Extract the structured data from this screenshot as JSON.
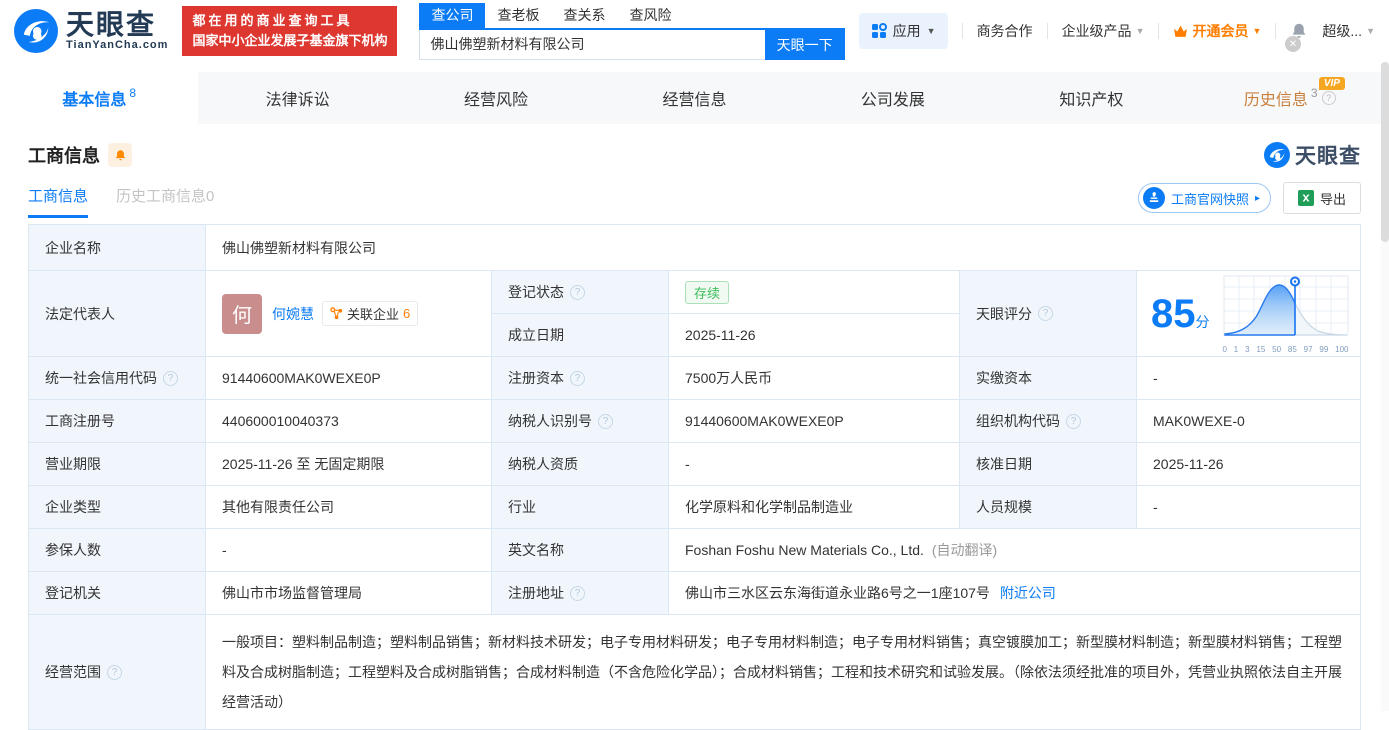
{
  "header": {
    "logo_title": "天眼查",
    "logo_domain": "TianYanCha.com",
    "slogan_line1": "都在用的商业查询工具",
    "slogan_line2": "国家中小企业发展子基金旗下机构",
    "search_tabs": [
      {
        "label": "查公司"
      },
      {
        "label": "查老板"
      },
      {
        "label": "查关系"
      },
      {
        "label": "查风险"
      }
    ],
    "search_value": "佛山佛塑新材料有限公司",
    "search_button": "天眼一下",
    "nav_apps": "应用",
    "nav_cooperation": "商务合作",
    "nav_enterprise": "企业级产品",
    "nav_vip": "开通会员",
    "nav_more": "超级..."
  },
  "tabs": [
    {
      "label": "基本信息",
      "count": "8"
    },
    {
      "label": "法律诉讼"
    },
    {
      "label": "经营风险"
    },
    {
      "label": "经营信息"
    },
    {
      "label": "公司发展"
    },
    {
      "label": "知识产权"
    },
    {
      "label": "历史信息",
      "count": "3",
      "badge": "VIP"
    }
  ],
  "section": {
    "title": "工商信息",
    "watermark": "天眼查",
    "subtab_active": "工商信息",
    "subtab_history": "历史工商信息0",
    "btn_snapshot": "工商官网快照",
    "btn_export": "导出"
  },
  "fields": {
    "company_name": {
      "label": "企业名称",
      "value": "佛山佛塑新材料有限公司"
    },
    "legal_rep": {
      "label": "法定代表人",
      "avatar": "何",
      "name": "何婉慧",
      "related_label": "关联企业",
      "related_count": "6"
    },
    "reg_status": {
      "label": "登记状态",
      "value": "存续"
    },
    "est_date": {
      "label": "成立日期",
      "value": "2025-11-26"
    },
    "credit_code": {
      "label": "统一社会信用代码",
      "value": "91440600MAK0WEXE0P"
    },
    "reg_capital": {
      "label": "注册资本",
      "value": "7500万人民币"
    },
    "paid_capital": {
      "label": "实缴资本",
      "value": "-"
    },
    "reg_number": {
      "label": "工商注册号",
      "value": "440600010040373"
    },
    "taxpayer_id": {
      "label": "纳税人识别号",
      "value": "91440600MAK0WEXE0P"
    },
    "org_code": {
      "label": "组织机构代码",
      "value": "MAK0WEXE-0"
    },
    "business_term": {
      "label": "营业期限",
      "value": "2025-11-26 至 无固定期限"
    },
    "taxpayer_quality": {
      "label": "纳税人资质",
      "value": "-"
    },
    "approval_date": {
      "label": "核准日期",
      "value": "2025-11-26"
    },
    "company_type": {
      "label": "企业类型",
      "value": "其他有限责任公司"
    },
    "industry": {
      "label": "行业",
      "value": "化学原料和化学制品制造业"
    },
    "staff_size": {
      "label": "人员规模",
      "value": "-"
    },
    "insured_count": {
      "label": "参保人数",
      "value": "-"
    },
    "english_name": {
      "label": "英文名称",
      "value": "Foshan Foshu New Materials Co., Ltd.",
      "note": "(自动翻译)"
    },
    "reg_authority": {
      "label": "登记机关",
      "value": "佛山市市场监督管理局"
    },
    "reg_address": {
      "label": "注册地址",
      "value": "佛山市三水区云东海街道永业路6号之一1座107号",
      "link": "附近公司"
    },
    "business_scope": {
      "label": "经营范围",
      "value": "一般项目：塑料制品制造；塑料制品销售；新材料技术研发；电子专用材料研发；电子专用材料制造；电子专用材料销售；真空镀膜加工；新型膜材料制造；新型膜材料销售；工程塑料及合成树脂制造；工程塑料及合成树脂销售；合成材料制造（不含危险化学品）；合成材料销售；工程和技术研究和试验发展。（除依法须经批准的项目外，凭营业执照依法自主开展经营活动）"
    }
  },
  "score": {
    "label": "天眼评分",
    "value": "85",
    "unit": "分"
  },
  "chart_data": {
    "type": "area",
    "title": "天眼评分分布曲线",
    "x_ticks": [
      "0",
      "1",
      "3",
      "15",
      "50",
      "85",
      "97",
      "99",
      "100"
    ],
    "marker_x": 85,
    "score": 85,
    "legend": [],
    "grid": true
  },
  "colors": {
    "primary_blue": "#0b7cf5",
    "orange": "#ff7d00",
    "banner_red": "#dd3730",
    "status_green": "#3dbd5b",
    "label_bg": "#f0f6fb",
    "avatar_bg": "#c98d8d"
  }
}
